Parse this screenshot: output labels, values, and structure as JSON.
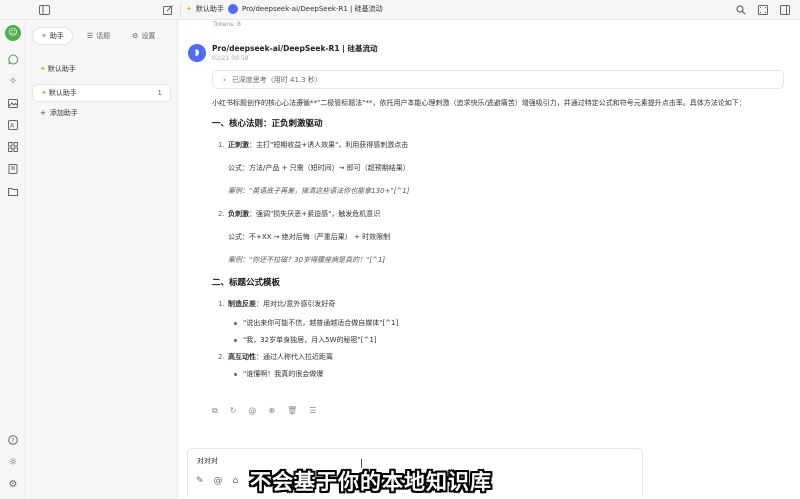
{
  "topbar": {
    "assistant_label": "默认助手",
    "model_title": "Pro/deepseek-ai/DeepSeek-R1 | 硅基流动"
  },
  "panel": {
    "tabs": [
      {
        "label": "助手",
        "icon": "star-icon"
      },
      {
        "label": "话题",
        "icon": "list-icon"
      },
      {
        "label": "设置",
        "icon": "gear-icon"
      }
    ],
    "assistants": [
      {
        "label": "默认助手"
      },
      {
        "label": "默认助手",
        "count": "1"
      }
    ],
    "add_label": "添加助手"
  },
  "message": {
    "tokens": "Tokens: 8",
    "sender": "Pro/deepseek-ai/DeepSeek-R1 | 硅基流动",
    "time": "02/21 09:58",
    "think_label": "已深度思考（用时 41.3 秒）",
    "intro": "小红书标题创作的核心心法遵循**\"二极管标题法\"**，依托用户本能心理刺激（追求快乐/逃避痛苦）增强吸引力，并通过特定公式和符号元素提升点击率。具体方法论如下：",
    "section1": {
      "heading": "一、核心法则：正负刺激驱动",
      "item1_num": "1.",
      "item1_bold": "正刺激",
      "item1_text": "：主打\"短期收益+诱人效果\"，利用获得感刺激点击",
      "item1_formula": "公式：方法/产品 + 只需（短时间）→ 即可（超预期结果）",
      "item1_case": "案例：\"英语底子再差，搞清这些语法你也能拿130+\"[^1]",
      "item2_num": "2.",
      "item2_bold": "负刺激",
      "item2_text": "：强调\"损失厌恶+紧迫感\"，触发危机意识",
      "item2_formula": "公式：不+XX → 绝对后悔（严重后果） + 时效限制",
      "item2_case": "案例：\"你还不拉磁？30岁得腰座病是真的！\"[^1]"
    },
    "section2": {
      "heading": "二、标题公式模板",
      "item1_num": "1.",
      "item1_bold": "制造反差",
      "item1_text": "：用对比/意外感引发好奇",
      "item1_bullets": [
        "\"说出来你可能不信，越普通越适合做自媒体\"[^1]",
        "\"我，32岁单身独居，月入5W的秘密\"[^1]"
      ],
      "item2_num": "2.",
      "item2_bold": "高互动性",
      "item2_text": "：通过人称代入拉近距离",
      "item2_bullets": [
        "\"谁懂啊！我真的很会做爆"
      ]
    }
  },
  "input": {
    "value": "对对对"
  },
  "subtitle": "不会基于你的本地知识库"
}
